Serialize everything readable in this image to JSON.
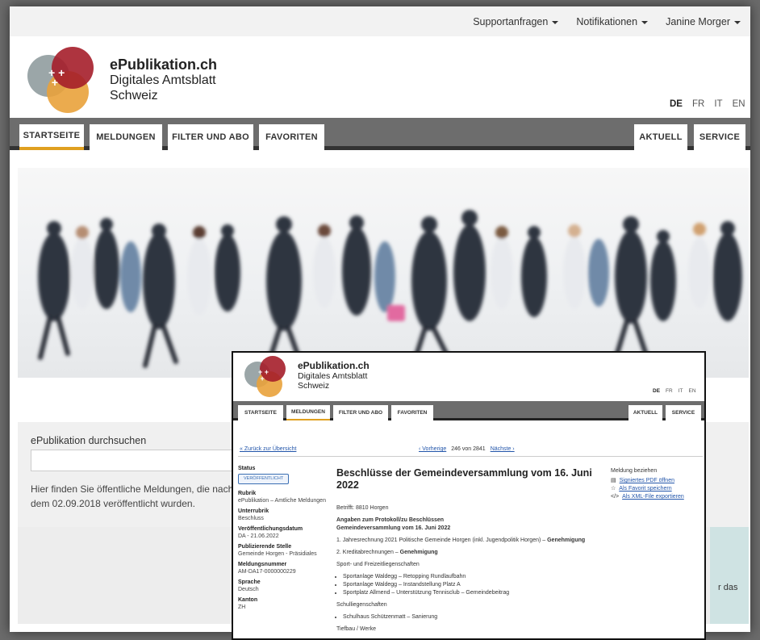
{
  "topbar": {
    "support": "Supportanfragen",
    "notifications": "Notifikationen",
    "user": "Janine Morger"
  },
  "brand": {
    "name": "ePublikation.ch",
    "line2": "Digitales Amtsblatt",
    "line3": "Schweiz"
  },
  "languages": [
    "DE",
    "FR",
    "IT",
    "EN"
  ],
  "nav": {
    "left": [
      "STARTSEITE",
      "MELDUNGEN",
      "FILTER UND ABO",
      "FAVORITEN"
    ],
    "right": [
      "AKTUELL",
      "SERVICE"
    ]
  },
  "search": {
    "title": "ePublikation durchsuchen",
    "placeholder": "",
    "info": "Hier finden Sie öffentliche Meldungen, die nach dem 02.09.2018 veröffentlicht wurden."
  },
  "teaser_fragment": "r das",
  "inset": {
    "back_link": "« Zurück zur Übersicht",
    "prev": "‹ Vorherige",
    "pager": "246 von 2841",
    "next": "Nächste ›",
    "status_label": "Status",
    "status_badge": "VERÖFFENTLICHT",
    "rubrik_label": "Rubrik",
    "rubrik": "ePublikation – Amtliche Meldungen",
    "unterrubrik_label": "Unterrubrik",
    "unterrubrik": "Beschluss",
    "datum_label": "Veröffentlichungsdatum",
    "datum": "DA - 21.06.2022",
    "stelle_label": "Publizierende Stelle",
    "stelle": "Gemeinde Horgen - Präsidiales",
    "nummer_label": "Meldungsnummer",
    "nummer": "AM-DA17-0000000229",
    "sprache_label": "Sprache",
    "sprache": "Deutsch",
    "kanton_label": "Kanton",
    "kanton": "ZH",
    "title": "Beschlüsse der Gemeindeversammlung vom 16. Juni 2022",
    "betrifft": "Betrifft: 8810 Horgen",
    "intro1": "Angaben zum Protokoll/zu Beschlüssen",
    "intro2": "Gemeindeversammlung vom 16. Juni 2022",
    "item1": "1. Jahresrechnung 2021 Politische Gemeinde Horgen (inkl. Jugendpolitik Horgen) – ",
    "item1_b": "Genehmigung",
    "item2": "2. Kreditabrechnungen – ",
    "item2_b": "Genehmigung",
    "section1": "Sport- und Freizeitliegenschaften",
    "bullets1": [
      "Sportanlage Waldegg – Retopping Rundlaufbahn",
      "Sportanlage Waldegg – Instandstellung Platz A",
      "Sportplatz Allmend – Unterstützung Tennisclub – Gemeindebeitrag"
    ],
    "section2": "Schulliegenschaften",
    "bullets2": [
      "Schulhaus Schützenmatt – Sanierung"
    ],
    "section3": "Tiefbau / Werke",
    "right_title": "Meldung beziehen",
    "right_links": [
      "Signiertes PDF öffnen",
      "Als Favorit speichern",
      "Als XML-File exportieren"
    ]
  },
  "colors": {
    "logo_red": "#a51e2a",
    "logo_orange": "#e9a23b",
    "logo_grey": "#7d8a8d",
    "nav_grey": "#6d6d6d",
    "accent": "#e0a020"
  }
}
